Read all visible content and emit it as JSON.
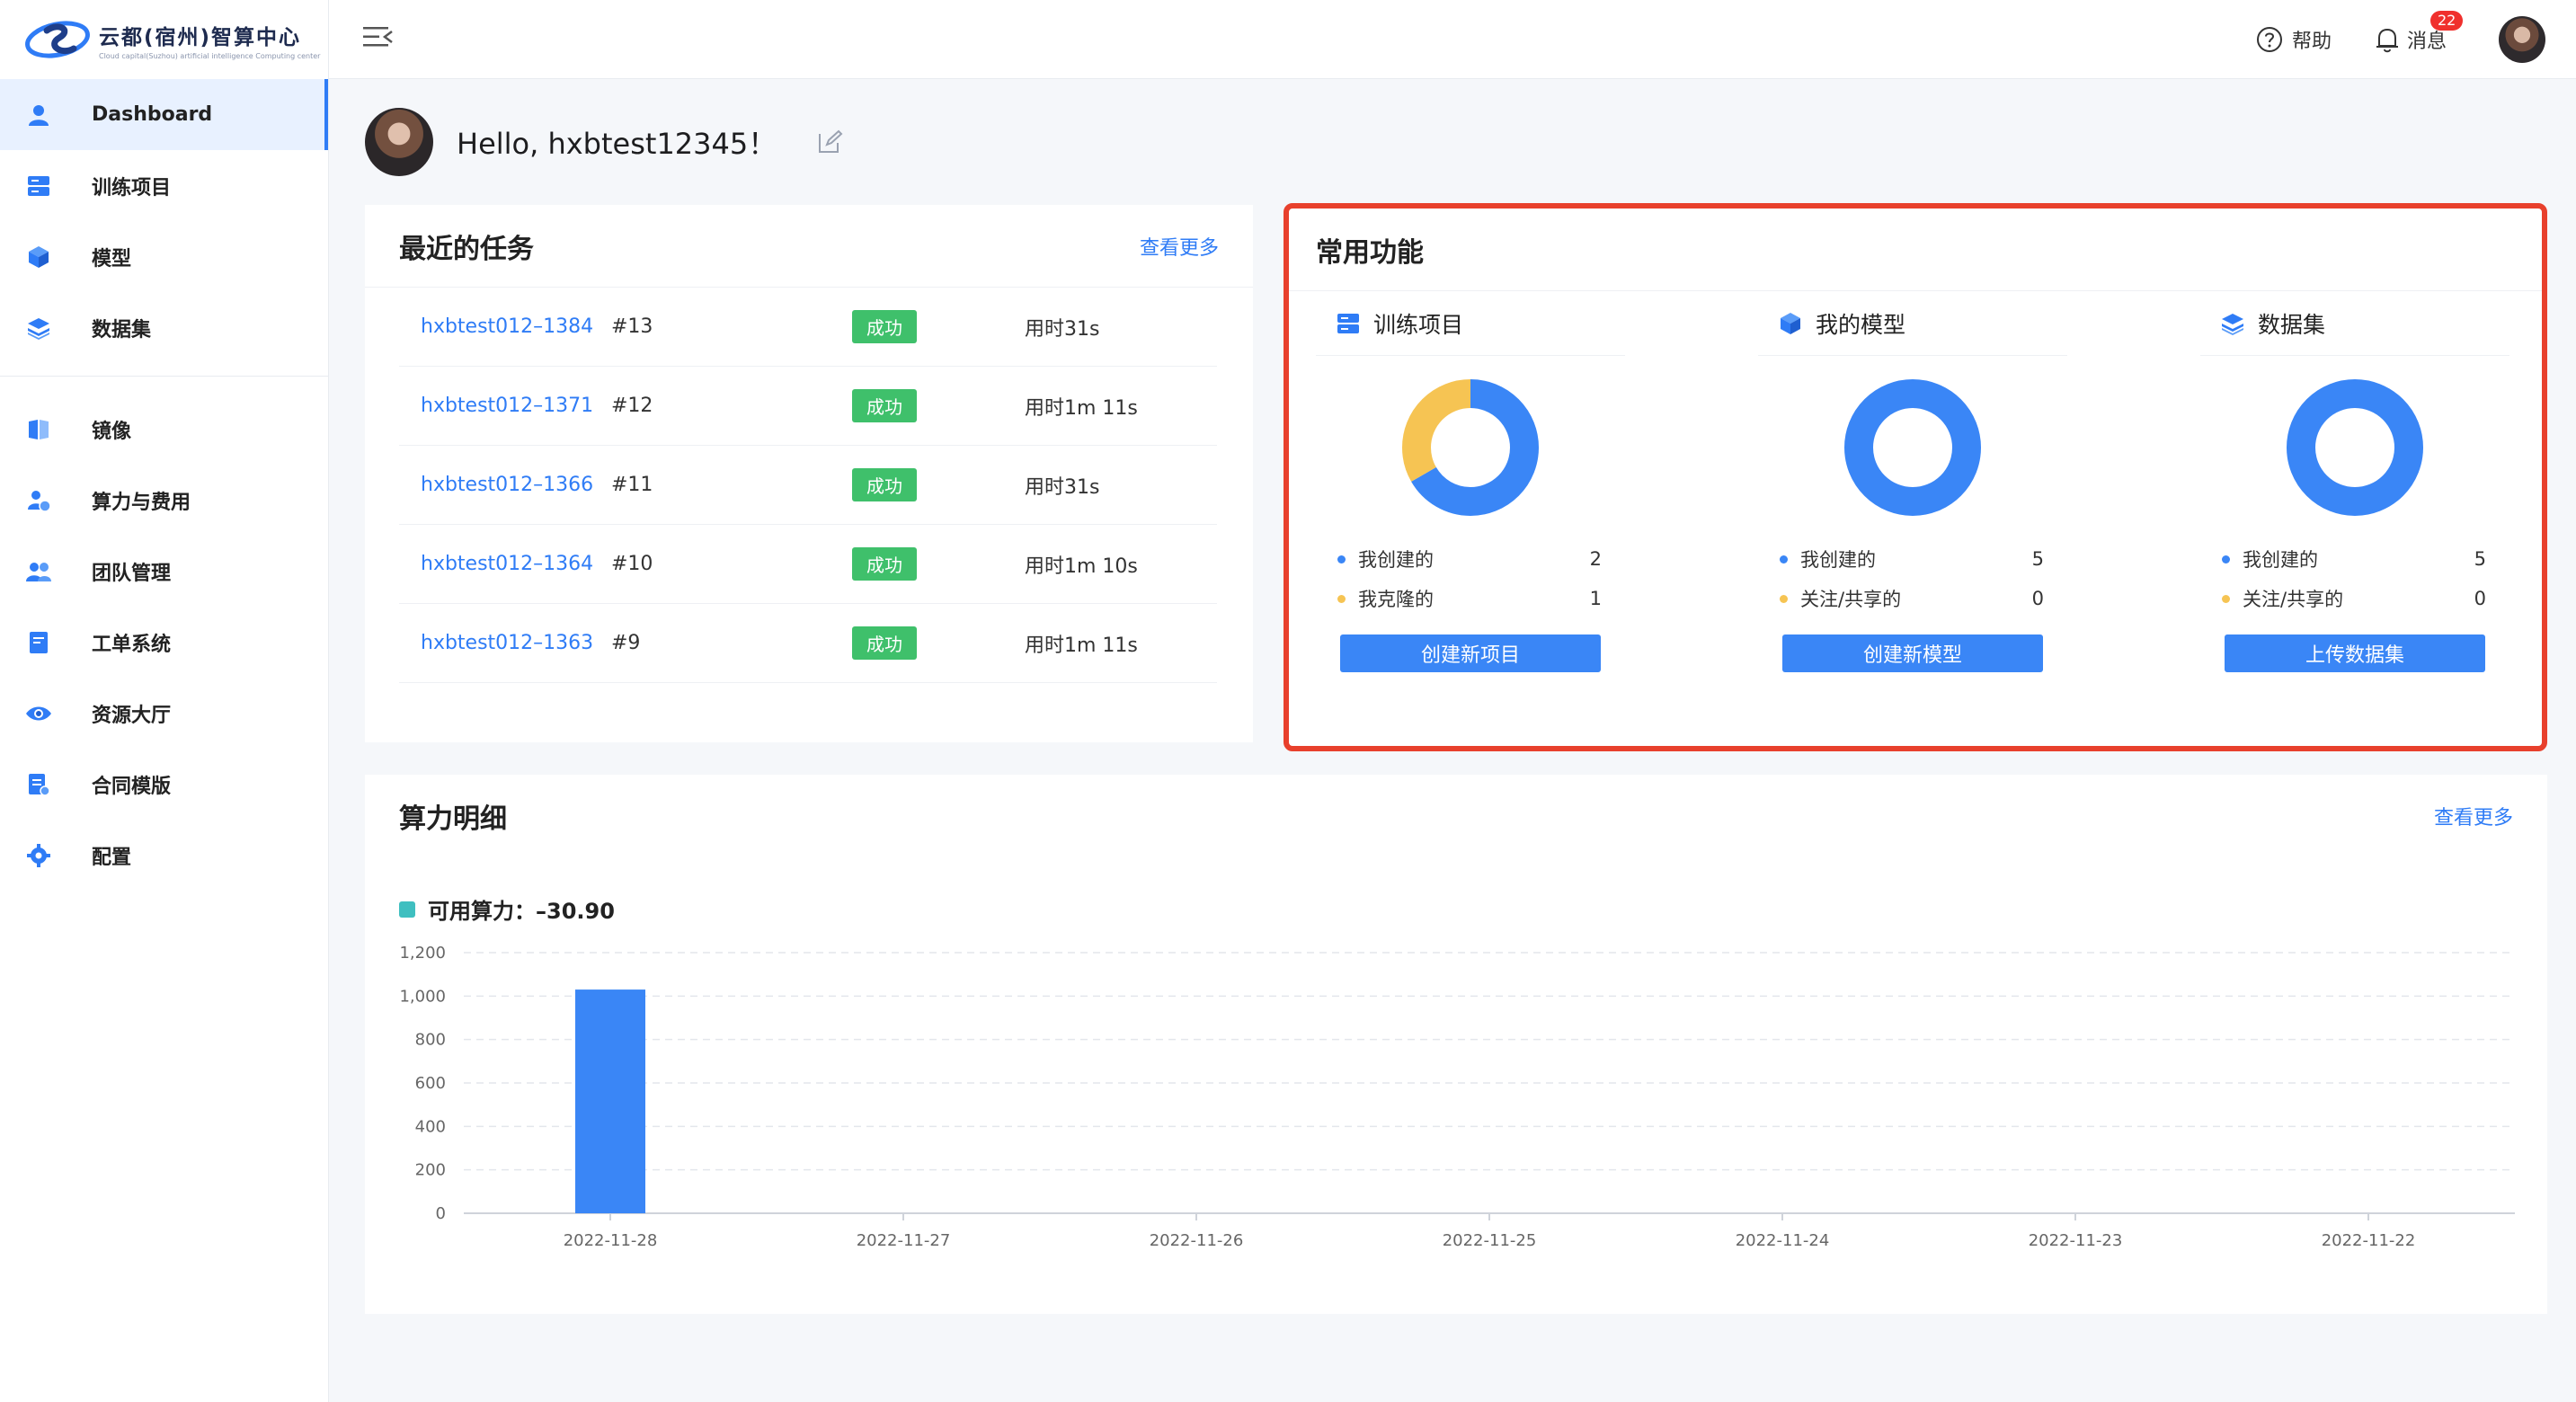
{
  "brand": {
    "name": "云都(宿州)智算中心",
    "subtitle": "Cloud capital(Suzhou) artificial intelligence Computing center"
  },
  "sidebar": {
    "items": [
      {
        "label": "Dashboard",
        "icon": "user-icon",
        "active": true
      },
      {
        "label": "训练项目",
        "icon": "server-icon"
      },
      {
        "label": "模型",
        "icon": "cube-icon"
      },
      {
        "label": "数据集",
        "icon": "layers-icon"
      },
      {
        "label": "镜像",
        "icon": "book-icon"
      },
      {
        "label": "算力与费用",
        "icon": "user-coin-icon"
      },
      {
        "label": "团队管理",
        "icon": "team-icon"
      },
      {
        "label": "工单系统",
        "icon": "ticket-icon"
      },
      {
        "label": "资源大厅",
        "icon": "eye-icon"
      },
      {
        "label": "合同模版",
        "icon": "contract-icon"
      },
      {
        "label": "配置",
        "icon": "gear-icon"
      }
    ]
  },
  "topbar": {
    "help": "帮助",
    "messages": "消息",
    "message_count": "22"
  },
  "greeting": "Hello, hxbtest12345！",
  "tasks": {
    "title": "最近的任务",
    "more": "查看更多",
    "rows": [
      {
        "name": "hxbtest012–1384",
        "num": "#13",
        "status": "成功",
        "duration": "用时31s"
      },
      {
        "name": "hxbtest012–1371",
        "num": "#12",
        "status": "成功",
        "duration": "用时1m 11s"
      },
      {
        "name": "hxbtest012–1366",
        "num": "#11",
        "status": "成功",
        "duration": "用时31s"
      },
      {
        "name": "hxbtest012–1364",
        "num": "#10",
        "status": "成功",
        "duration": "用时1m 10s"
      },
      {
        "name": "hxbtest012–1363",
        "num": "#9",
        "status": "成功",
        "duration": "用时1m 11s"
      }
    ]
  },
  "common": {
    "title": "常用功能",
    "columns": [
      {
        "title": "训练项目",
        "icon": "server-icon",
        "legend": [
          {
            "label": "我创建的",
            "value": 2
          },
          {
            "label": "我克隆的",
            "value": 1
          }
        ],
        "button": "创建新项目"
      },
      {
        "title": "我的模型",
        "icon": "cube-icon",
        "legend": [
          {
            "label": "我创建的",
            "value": 5
          },
          {
            "label": "关注/共享的",
            "value": 0
          }
        ],
        "button": "创建新模型"
      },
      {
        "title": "数据集",
        "icon": "layers-icon",
        "legend": [
          {
            "label": "我创建的",
            "value": 5
          },
          {
            "label": "关注/共享的",
            "value": 0
          }
        ],
        "button": "上传数据集"
      }
    ]
  },
  "colors": {
    "primary": "#3a86f6",
    "secondary": "#f6c453",
    "success": "#3fc06b",
    "highlight": "#e8402c",
    "legend": "#3fbfc0"
  },
  "compute": {
    "title": "算力明细",
    "more": "查看更多",
    "legend": "可用算力：–30.90"
  },
  "chart_data": {
    "type": "bar",
    "categories": [
      "2022-11-28",
      "2022-11-27",
      "2022-11-26",
      "2022-11-25",
      "2022-11-24",
      "2022-11-23",
      "2022-11-22"
    ],
    "values": [
      1030,
      0,
      0,
      0,
      0,
      0,
      0
    ],
    "ylim": [
      0,
      1200
    ],
    "yticks": [
      "0",
      "200",
      "400",
      "600",
      "800",
      "1,000",
      "1,200"
    ],
    "grid": true
  }
}
